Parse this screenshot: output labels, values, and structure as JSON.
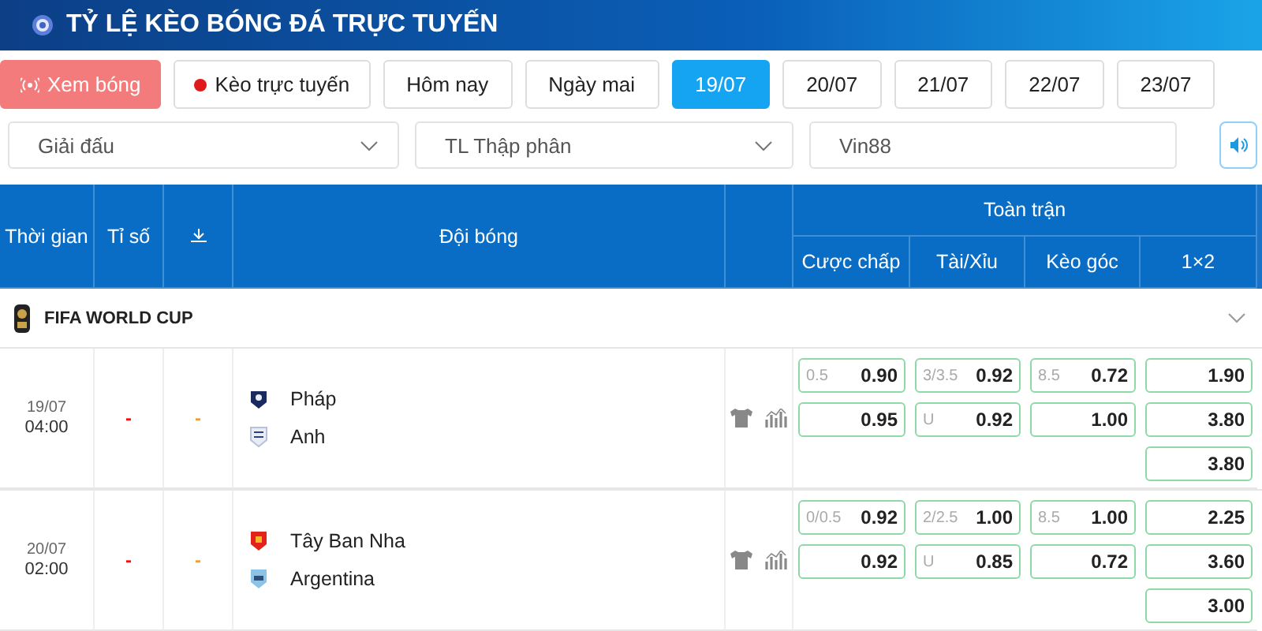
{
  "header": {
    "title": "TỶ LỆ KÈO BÓNG ĐÁ TRỰC TUYẾN"
  },
  "filters": [
    {
      "label": "Xem bóng",
      "kind": "watch",
      "selected": false
    },
    {
      "label": "Kèo trực tuyến",
      "kind": "live",
      "selected": false
    },
    {
      "label": "Hôm nay",
      "kind": "plain",
      "selected": false
    },
    {
      "label": "Ngày mai",
      "kind": "plain",
      "selected": false
    },
    {
      "label": "19/07",
      "kind": "plain",
      "selected": true
    },
    {
      "label": "20/07",
      "kind": "plain",
      "selected": false
    },
    {
      "label": "21/07",
      "kind": "plain",
      "selected": false
    },
    {
      "label": "22/07",
      "kind": "plain",
      "selected": false
    },
    {
      "label": "23/07",
      "kind": "plain",
      "selected": false
    }
  ],
  "selects": [
    {
      "value": "Giải đấu",
      "kind": "dropdown"
    },
    {
      "value": "TL Thập phân",
      "kind": "dropdown"
    },
    {
      "value": "Vin88",
      "kind": "text"
    }
  ],
  "table": {
    "columns": [
      "Thời gian",
      "Tỉ số",
      "Đội bóng"
    ],
    "group_header": "Toàn trận",
    "odds_columns": [
      "Cược chấp",
      "Tài/Xỉu",
      "Kèo góc",
      "1×2"
    ],
    "league": "FIFA WORLD CUP",
    "matches": [
      {
        "date": "19/07",
        "time": "04:00",
        "score": "-",
        "half_score": "-",
        "home": "Pháp",
        "away": "Anh",
        "odds": [
          [
            {
              "line": "0.5",
              "value": "0.90"
            },
            {
              "value": "0.95"
            }
          ],
          [
            {
              "line": "3/3.5",
              "value": "0.92"
            },
            {
              "line": "U",
              "value": "0.92"
            }
          ],
          [
            {
              "line": "8.5",
              "value": "0.72"
            },
            {
              "value": "1.00"
            }
          ],
          [
            {
              "value": "1.90"
            },
            {
              "value": "3.80"
            },
            {
              "value": "3.80"
            }
          ]
        ]
      },
      {
        "date": "20/07",
        "time": "02:00",
        "score": "-",
        "half_score": "-",
        "home": "Tây Ban Nha",
        "away": "Argentina",
        "odds": [
          [
            {
              "line": "0/0.5",
              "value": "0.92"
            },
            {
              "value": "0.92"
            }
          ],
          [
            {
              "line": "2/2.5",
              "value": "1.00"
            },
            {
              "line": "U",
              "value": "0.85"
            }
          ],
          [
            {
              "line": "8.5",
              "value": "1.00"
            },
            {
              "value": "0.72"
            }
          ],
          [
            {
              "value": "2.25"
            },
            {
              "value": "3.60"
            },
            {
              "value": "3.00"
            }
          ]
        ]
      }
    ]
  }
}
